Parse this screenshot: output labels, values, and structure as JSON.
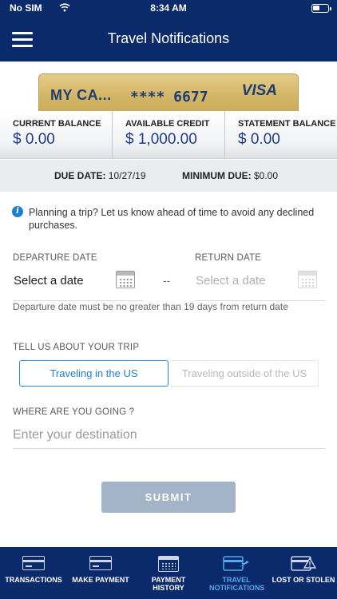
{
  "status_bar": {
    "carrier": "No SIM",
    "time": "8:34 AM"
  },
  "header": {
    "title": "Travel Notifications"
  },
  "card": {
    "name": "MY CA...",
    "number": "**** 6677",
    "brand": "VISA"
  },
  "balances": [
    {
      "label": "CURRENT BALANCE",
      "value": "$ 0.00"
    },
    {
      "label": "AVAILABLE CREDIT",
      "value": "$ 1,000.00"
    },
    {
      "label": "STATEMENT BALANCE",
      "value": "$ 0.00"
    }
  ],
  "due": {
    "due_label": "DUE DATE:",
    "due_value": "10/27/19",
    "min_label": "MINIMUM DUE:",
    "min_value": "$0.00"
  },
  "form": {
    "info": "Planning a trip? Let us know ahead of time to avoid any declined purchases.",
    "departure_label": "DEPARTURE DATE",
    "departure_value": "Select a date",
    "separator": "--",
    "return_label": "RETURN DATE",
    "return_value": "Select a date",
    "hint": "Departure date must be no greater than 19 days from return date",
    "trip_label": "TELL US ABOUT YOUR TRIP",
    "trip_options": [
      "Traveling in the US",
      "Traveling outside of the US"
    ],
    "destination_label": "WHERE ARE YOU GOING ?",
    "destination_placeholder": "Enter your destination",
    "submit": "SUBMIT"
  },
  "tabs": [
    {
      "label": "TRANSACTIONS",
      "icon": "card-icon"
    },
    {
      "label": "MAKE PAYMENT",
      "icon": "card-icon"
    },
    {
      "label": "PAYMENT HISTORY",
      "icon": "calendar-icon"
    },
    {
      "label": "TRAVEL NOTIFICATIONS",
      "icon": "card-plane-icon",
      "active": true
    },
    {
      "label": "LOST OR STOLEN",
      "icon": "card-alert-icon"
    }
  ],
  "colors": {
    "navy": "#0b2a6b",
    "accent": "#1f7fd0",
    "balance_value": "#1f3c8b",
    "submit_disabled": "#a3b4c8"
  }
}
